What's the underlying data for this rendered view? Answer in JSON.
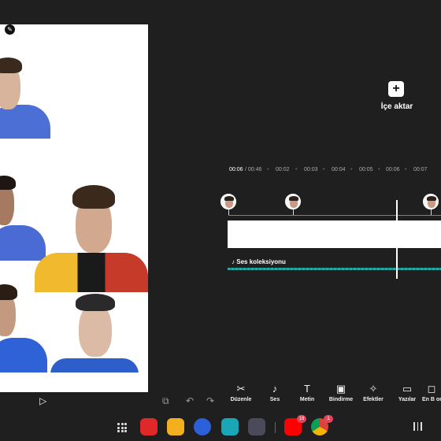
{
  "preview": {
    "edit_icon": "pencil-icon"
  },
  "editor_controls": {
    "play_icon": "play-icon",
    "screen_toggle_icon": "screen-off-icon",
    "undo_icon": "undo-icon",
    "redo_icon": "redo-icon"
  },
  "import": {
    "icon": "plus-icon",
    "label": "İçe aktar"
  },
  "timeline": {
    "current_time": "00:06",
    "total_time": "/ 00:46",
    "ticks": [
      "00:02",
      "00:03",
      "00:04",
      "00:05",
      "00:06",
      "00:07"
    ],
    "audio_label": "Ses koleksiyonu",
    "audio_icon": "music-note-icon"
  },
  "toolbar": [
    {
      "label": "Düzenle",
      "icon": "scissors-icon",
      "glyph": "✂"
    },
    {
      "label": "Ses",
      "icon": "music-note-icon",
      "glyph": "♪"
    },
    {
      "label": "Metin",
      "icon": "text-icon",
      "glyph": "T"
    },
    {
      "label": "Bindirme",
      "icon": "overlay-icon",
      "glyph": "▣"
    },
    {
      "label": "Efektler",
      "icon": "sparkle-icon",
      "glyph": "✧"
    },
    {
      "label": "Yazılar",
      "icon": "subtitles-icon",
      "glyph": "▭"
    },
    {
      "label": "En B ora",
      "icon": "aspect-ratio-icon",
      "glyph": "◻"
    }
  ],
  "dock": {
    "apps": [
      {
        "name": "flipboard-app",
        "color": "#e12828"
      },
      {
        "name": "my-files-app",
        "color": "#f2b01e"
      },
      {
        "name": "game-app",
        "color": "#2c5fd8"
      },
      {
        "name": "calendar-app",
        "color": "#1aa6b7"
      },
      {
        "name": "camera-app",
        "color": "#4a4a5a"
      },
      {
        "name": "youtube-app",
        "color": "#ff0000",
        "badge": "18"
      },
      {
        "name": "chrome-app",
        "color": "#2e9d4f",
        "badge": "1"
      }
    ]
  }
}
